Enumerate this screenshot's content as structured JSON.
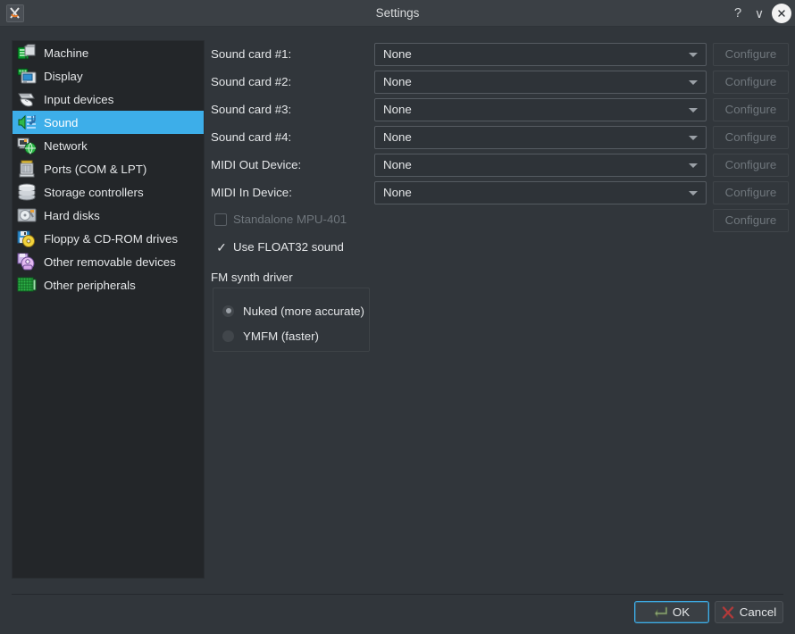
{
  "window": {
    "title": "Settings",
    "app_icon": "86box-logo-icon",
    "titlebar_buttons": [
      {
        "name": "help-button",
        "glyph": "?"
      },
      {
        "name": "menu-chevron-button",
        "glyph": "∨"
      },
      {
        "name": "close-button",
        "glyph": "✕"
      }
    ]
  },
  "colors": {
    "accent": "#3daee9",
    "window_bg": "#31363b",
    "list_bg": "#232629",
    "text": "#e4e6e8",
    "disabled_text": "#6f767c"
  },
  "sidebar": {
    "selected": "Sound",
    "items": [
      {
        "label": "Machine",
        "icon": "machine-chip-icon"
      },
      {
        "label": "Display",
        "icon": "monitor-icon"
      },
      {
        "label": "Input devices",
        "icon": "keyboard-mouse-icon"
      },
      {
        "label": "Sound",
        "icon": "speaker-notes-icon"
      },
      {
        "label": "Network",
        "icon": "network-globe-icon"
      },
      {
        "label": "Ports (COM & LPT)",
        "icon": "serial-port-icon"
      },
      {
        "label": "Storage controllers",
        "icon": "storage-stack-icon"
      },
      {
        "label": "Hard disks",
        "icon": "hard-disk-icon"
      },
      {
        "label": "Floppy & CD-ROM drives",
        "icon": "floppy-cdrom-icon"
      },
      {
        "label": "Other removable devices",
        "icon": "removable-device-icon"
      },
      {
        "label": "Other peripherals",
        "icon": "peripherals-grid-icon"
      }
    ]
  },
  "main": {
    "device_rows": [
      {
        "label": "Sound card #1:",
        "value": "None",
        "button": "Configure",
        "button_enabled": false
      },
      {
        "label": "Sound card #2:",
        "value": "None",
        "button": "Configure",
        "button_enabled": false
      },
      {
        "label": "Sound card #3:",
        "value": "None",
        "button": "Configure",
        "button_enabled": false
      },
      {
        "label": "Sound card #4:",
        "value": "None",
        "button": "Configure",
        "button_enabled": false
      },
      {
        "label": "MIDI Out Device:",
        "value": "None",
        "button": "Configure",
        "button_enabled": false
      },
      {
        "label": "MIDI In Device:",
        "value": "None",
        "button": "Configure",
        "button_enabled": false
      }
    ],
    "mpu401": {
      "label": "Standalone MPU-401",
      "checked": false,
      "enabled": false,
      "button": "Configure"
    },
    "float32": {
      "label": "Use FLOAT32 sound",
      "checked": true,
      "tick": "✓"
    },
    "fm_synth": {
      "title": "FM synth driver",
      "options": [
        {
          "label": "Nuked (more accurate)",
          "selected": true
        },
        {
          "label": "YMFM (faster)",
          "selected": false
        }
      ]
    }
  },
  "footer": {
    "ok": {
      "label": "OK",
      "icon": "enter-arrow-icon"
    },
    "cancel": {
      "label": "Cancel",
      "icon": "red-x-icon"
    }
  }
}
